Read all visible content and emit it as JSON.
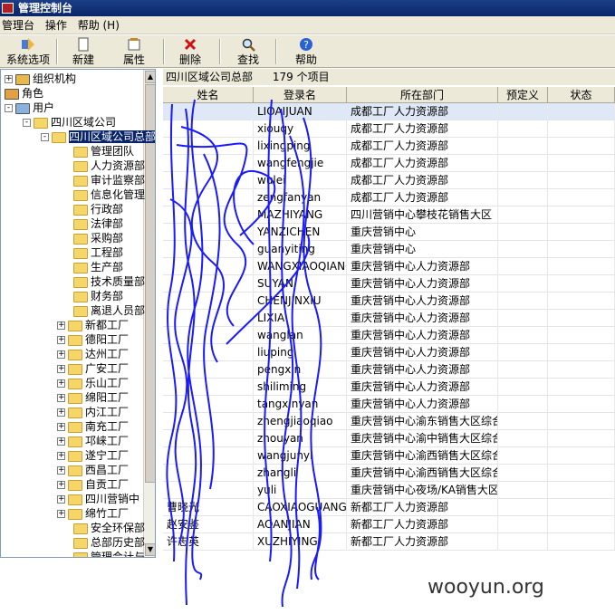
{
  "window": {
    "title": "管理控制台"
  },
  "menu": [
    "管理台",
    "操作",
    "帮助 (H)"
  ],
  "toolbar": {
    "buttons": [
      {
        "label": "系统选项",
        "icon": "system-options-icon"
      },
      {
        "label": "新建",
        "icon": "new-document-icon"
      },
      {
        "label": "属性",
        "icon": "properties-icon"
      },
      {
        "label": "删除",
        "icon": "delete-x-icon"
      },
      {
        "label": "查找",
        "icon": "find-magnifier-icon"
      },
      {
        "label": "帮助",
        "icon": "help-icon"
      }
    ]
  },
  "tree": {
    "roots": [
      "组织机构",
      "角色",
      "用户"
    ],
    "company": "四川区域公司",
    "hq": "四川区域公司总部",
    "departments": [
      "管理团队",
      "人力资源部",
      "审计监察部",
      "信息化管理",
      "行政部",
      "法律部",
      "采购部",
      "工程部",
      "生产部",
      "技术质量部",
      "财务部",
      "离退人员部"
    ],
    "factories": [
      "新都工厂",
      "德阳工厂",
      "达州工厂",
      "广安工厂",
      "乐山工厂",
      "绵阳工厂",
      "内江工厂",
      "南充工厂",
      "邛崃工厂",
      "遂宁工厂",
      "西昌工厂",
      "自贡工厂",
      "四川营销中",
      "绵竹工厂"
    ],
    "tail": [
      "安全环保部",
      "总部历史部",
      "管理会计与"
    ]
  },
  "list": {
    "location": "四川区域公司总部",
    "count": "179 个项目",
    "columns": [
      "姓名",
      "登录名",
      "所在部门",
      "预定义",
      "状态"
    ],
    "rows": [
      [
        "",
        "LIOAIJUAN",
        "成都工厂人力资源部"
      ],
      [
        "",
        "xiouqy",
        "成都工厂人力资源部"
      ],
      [
        "",
        "lixingping",
        "成都工厂人力资源部"
      ],
      [
        "",
        "wangfengjie",
        "成都工厂人力资源部"
      ],
      [
        "",
        "wulei",
        "成都工厂人力资源部"
      ],
      [
        "",
        "zengfanyan",
        "成都工厂人力资源部"
      ],
      [
        "",
        "MAZHIYANG",
        "四川营销中心攀枝花销售大区"
      ],
      [
        "",
        "YANZICHEN",
        "重庆营销中心"
      ],
      [
        "",
        "guanyiting",
        "重庆营销中心"
      ],
      [
        "",
        "WANGXIAOQIANG",
        "重庆营销中心人力资源部"
      ],
      [
        "",
        "SUYAN",
        "重庆营销中心人力资源部"
      ],
      [
        "",
        "CHENJINXIU",
        "重庆营销中心人力资源部"
      ],
      [
        "",
        "LIXIA",
        "重庆营销中心人力资源部"
      ],
      [
        "",
        "wanglan",
        "重庆营销中心人力资源部"
      ],
      [
        "",
        "liuping",
        "重庆营销中心人力资源部"
      ],
      [
        "",
        "pengxin",
        "重庆营销中心人力资源部"
      ],
      [
        "",
        "shiliming",
        "重庆营销中心人力资源部"
      ],
      [
        "",
        "tangxinyan",
        "重庆营销中心人力资源部"
      ],
      [
        "",
        "zhengjiaoqiao",
        "重庆营销中心渝东销售大区综合"
      ],
      [
        "",
        "zhouyan",
        "重庆营销中心渝中销售大区综合"
      ],
      [
        "",
        "wangjunyi",
        "重庆营销中心渝西销售大区综合"
      ],
      [
        "",
        "zhangli",
        "重庆营销中心渝西销售大区综合"
      ],
      [
        "",
        "yuli",
        "重庆营销中心夜场/KA销售大区"
      ],
      [
        "曹晓光",
        "CAOXIAOGUANG",
        "新都工厂人力资源部"
      ],
      [
        "赵安鉴",
        "AOANJIAN",
        "新都工厂人力资源部"
      ],
      [
        "许志英",
        "XUZHIYING",
        "新都工厂人力资源部"
      ]
    ]
  },
  "watermark": "wooyun.org",
  "colors": {
    "selection": "#0a246a",
    "scribble": "#1a1aff",
    "toolbar": "#ece9d8"
  }
}
